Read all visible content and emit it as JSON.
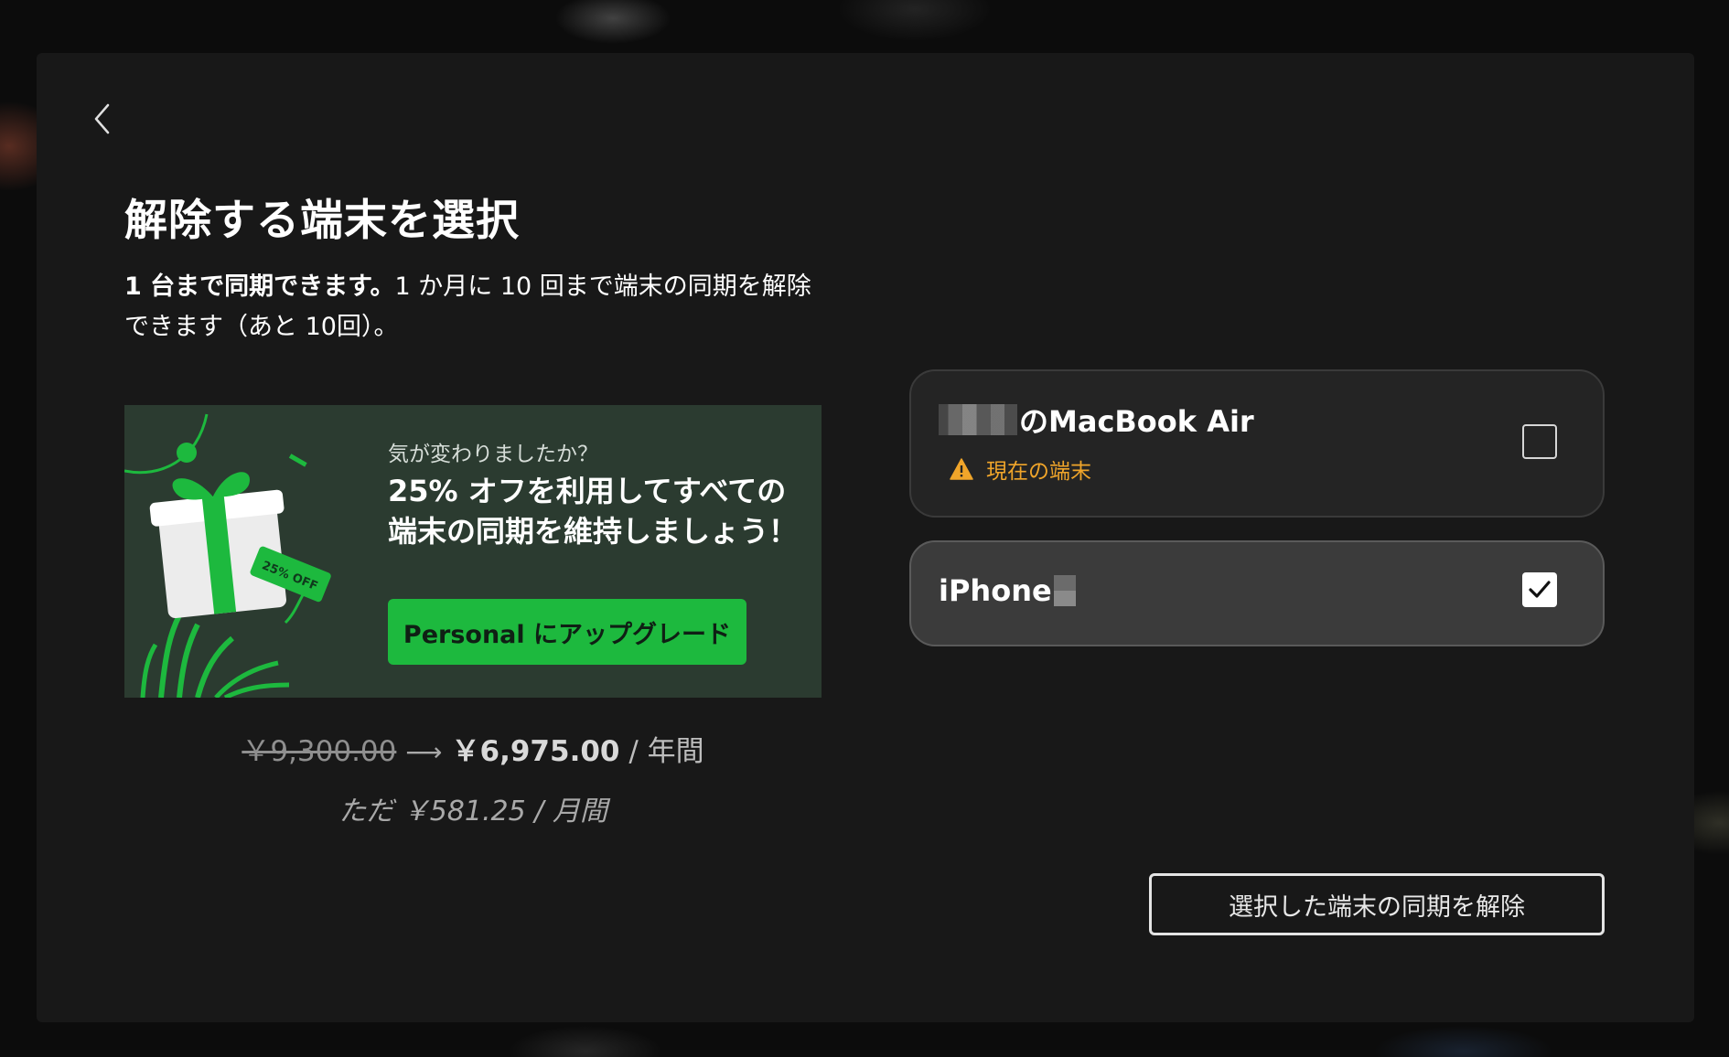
{
  "modal": {
    "title": "解除する端末を選択",
    "description_bold": "1 台まで同期できます。",
    "description_rest": "1 か月に 10 回まで端末の同期を解除できます（あと 10回）。"
  },
  "promo": {
    "subtitle": "気が変わりましたか？",
    "headline": "25% オフを利用してすべての端末の同期を維持しましょう！",
    "tag_text": "25% OFF",
    "button_label": "Personal にアップグレード",
    "accent_color": "#1db93e"
  },
  "pricing": {
    "old_price": "￥9,300.00",
    "arrow": "⟶",
    "new_price": "￥6,975.00",
    "period": "/ 年間",
    "monthly": "ただ ￥581.25 / 月間"
  },
  "devices": [
    {
      "name": "のMacBook Air",
      "note": "現在の端末",
      "note_color": "#f0a52a",
      "checked": false
    },
    {
      "name": "iPhone",
      "checked": true
    }
  ],
  "actions": {
    "unsync_label": "選択した端末の同期を解除"
  },
  "icons": {
    "back": "chevron-left-icon",
    "warning": "warning-icon",
    "check": "checkmark-icon",
    "gift": "gift-icon"
  }
}
